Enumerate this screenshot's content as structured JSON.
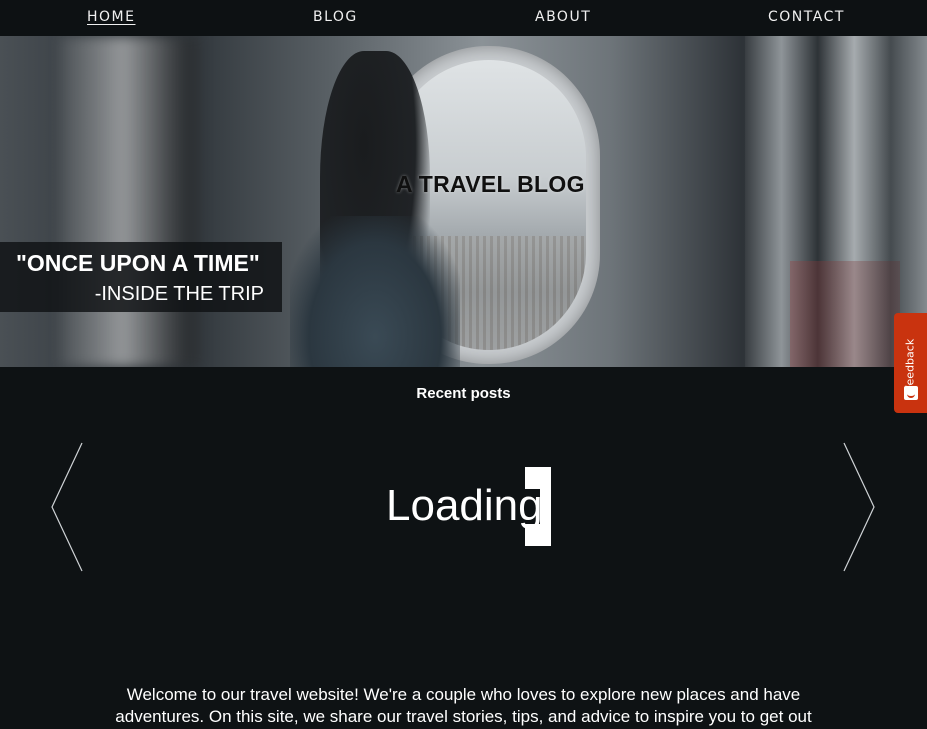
{
  "nav": {
    "items": [
      {
        "label": "HOME",
        "active": true
      },
      {
        "label": "BLOG",
        "active": false
      },
      {
        "label": "ABOUT",
        "active": false
      },
      {
        "label": "CONTACT",
        "active": false
      }
    ]
  },
  "hero": {
    "title": "A TRAVEL BLOG",
    "quote_line1": "\"ONCE UPON A TIME\"",
    "quote_line2": "-INSIDE THE TRIP"
  },
  "recent": {
    "heading": "Recent posts",
    "loading_text": "Loading",
    "prev_icon": "chevron-left-icon",
    "next_icon": "chevron-right-icon"
  },
  "welcome": {
    "text": "Welcome to our travel website! We're a couple who loves to explore new places and have adventures. On this site, we share our travel stories, tips, and advice to inspire you to get out"
  },
  "feedback": {
    "label": "Feedback",
    "icon": "smile-icon",
    "color": "#c9330f"
  },
  "colors": {
    "background": "#0e1214",
    "nav_background": "#0d1113",
    "text": "#ffffff"
  }
}
